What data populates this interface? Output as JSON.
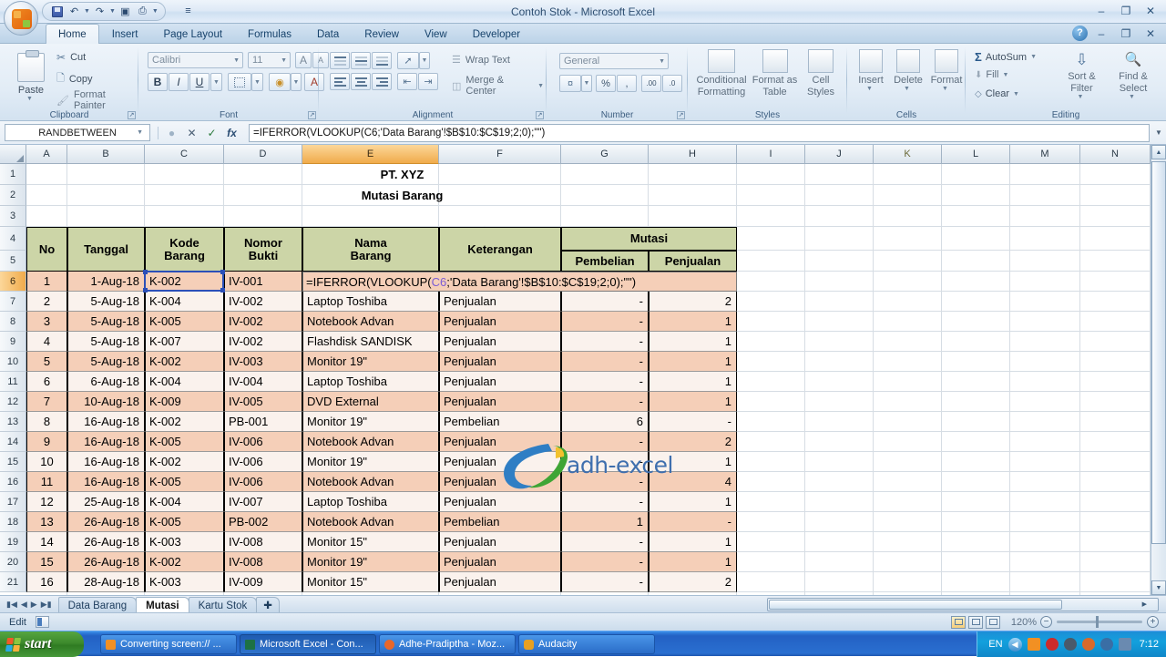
{
  "window": {
    "title": "Contoh Stok - Microsoft Excel",
    "minimize": "–",
    "restore": "❐",
    "close": "✕",
    "help": "?"
  },
  "quick_access": {
    "save": "save-icon",
    "undo": "undo-icon",
    "redo": "redo-icon",
    "camera": "camera-icon",
    "print_preview": "print-icon",
    "customize": "≡"
  },
  "ribbon": {
    "tabs": [
      {
        "label": "Home",
        "active": true
      },
      {
        "label": "Insert",
        "active": false
      },
      {
        "label": "Page Layout",
        "active": false
      },
      {
        "label": "Formulas",
        "active": false
      },
      {
        "label": "Data",
        "active": false
      },
      {
        "label": "Review",
        "active": false
      },
      {
        "label": "View",
        "active": false
      },
      {
        "label": "Developer",
        "active": false
      }
    ],
    "groups": {
      "clipboard": {
        "label": "Clipboard",
        "paste": "Paste",
        "cut": "Cut",
        "copy": "Copy",
        "format_painter": "Format Painter"
      },
      "font": {
        "label": "Font",
        "font_name": "Calibri",
        "font_size": "11",
        "grow": "A",
        "shrink": "A",
        "bold": "B",
        "italic": "I",
        "underline": "U",
        "borders": "borders-icon",
        "fill_color": "fill-color-icon",
        "font_color": "A"
      },
      "alignment": {
        "label": "Alignment",
        "wrap_text": "Wrap Text",
        "merge_center": "Merge & Center"
      },
      "number": {
        "label": "Number",
        "format": "General",
        "accounting": "accounting-icon",
        "percent": "%",
        "comma": ",",
        "increase_decimal": "increase-decimal-icon",
        "decrease_decimal": "decrease-decimal-icon"
      },
      "styles": {
        "label": "Styles",
        "conditional_formatting": "Conditional Formatting",
        "format_as_table": "Format as Table",
        "cell_styles": "Cell Styles"
      },
      "cells": {
        "label": "Cells",
        "insert": "Insert",
        "delete": "Delete",
        "format": "Format"
      },
      "editing": {
        "label": "Editing",
        "autosum": "AutoSum",
        "fill": "Fill",
        "clear": "Clear",
        "sort_filter": "Sort & Filter",
        "find_select": "Find & Select"
      }
    }
  },
  "formula_bar": {
    "name_box": "RANDBETWEEN",
    "cancel": "✕",
    "enter": "✓",
    "insert_function": "fx",
    "formula": "=IFERROR(VLOOKUP(C6;'Data Barang'!$B$10:$C$19;2;0);\"\")"
  },
  "grid": {
    "columns": [
      "A",
      "B",
      "C",
      "D",
      "E",
      "F",
      "G",
      "H",
      "I",
      "J",
      "K",
      "L",
      "M",
      "N"
    ],
    "selected_column": "E",
    "rows": [
      "1",
      "2",
      "3",
      "4",
      "5",
      "6",
      "7",
      "8",
      "9",
      "10",
      "11",
      "12",
      "13",
      "14",
      "15",
      "16",
      "17",
      "18",
      "19",
      "20",
      "21"
    ],
    "selected_row": "6",
    "title_line1": "PT. XYZ",
    "title_line2": "Mutasi Barang",
    "headers": {
      "no": "No",
      "tanggal": "Tanggal",
      "kode_barang_1": "Kode",
      "kode_barang_2": "Barang",
      "nomor_bukti_1": "Nomor",
      "nomor_bukti_2": "Bukti",
      "nama_barang_1": "Nama",
      "nama_barang_2": "Barang",
      "keterangan": "Keterangan",
      "mutasi": "Mutasi",
      "pembelian": "Pembelian",
      "penjualan": "Penjualan"
    },
    "active_cell_formula": "=IFERROR(VLOOKUP(C6;'Data Barang'!$B$10:$C$19;2;0);\"\")",
    "active_cell_formula_ref": "C6",
    "data": [
      {
        "no": "1",
        "tanggal": "1-Aug-18",
        "kode": "K-002",
        "bukti": "IV-001",
        "nama": "",
        "ket": "",
        "beli": "",
        "jual": ""
      },
      {
        "no": "2",
        "tanggal": "5-Aug-18",
        "kode": "K-004",
        "bukti": "IV-002",
        "nama": "Laptop Toshiba",
        "ket": "Penjualan",
        "beli": "-",
        "jual": "2"
      },
      {
        "no": "3",
        "tanggal": "5-Aug-18",
        "kode": "K-005",
        "bukti": "IV-002",
        "nama": "Notebook Advan",
        "ket": "Penjualan",
        "beli": "-",
        "jual": "1"
      },
      {
        "no": "4",
        "tanggal": "5-Aug-18",
        "kode": "K-007",
        "bukti": "IV-002",
        "nama": "Flashdisk SANDISK",
        "ket": "Penjualan",
        "beli": "-",
        "jual": "1"
      },
      {
        "no": "5",
        "tanggal": "5-Aug-18",
        "kode": "K-002",
        "bukti": "IV-003",
        "nama": "Monitor 19\"",
        "ket": "Penjualan",
        "beli": "-",
        "jual": "1"
      },
      {
        "no": "6",
        "tanggal": "6-Aug-18",
        "kode": "K-004",
        "bukti": "IV-004",
        "nama": "Laptop Toshiba",
        "ket": "Penjualan",
        "beli": "-",
        "jual": "1"
      },
      {
        "no": "7",
        "tanggal": "10-Aug-18",
        "kode": "K-009",
        "bukti": "IV-005",
        "nama": "DVD External",
        "ket": "Penjualan",
        "beli": "-",
        "jual": "1"
      },
      {
        "no": "8",
        "tanggal": "16-Aug-18",
        "kode": "K-002",
        "bukti": "PB-001",
        "nama": "Monitor 19\"",
        "ket": "Pembelian",
        "beli": "6",
        "jual": "-"
      },
      {
        "no": "9",
        "tanggal": "16-Aug-18",
        "kode": "K-005",
        "bukti": "IV-006",
        "nama": "Notebook Advan",
        "ket": "Penjualan",
        "beli": "-",
        "jual": "2"
      },
      {
        "no": "10",
        "tanggal": "16-Aug-18",
        "kode": "K-002",
        "bukti": "IV-006",
        "nama": "Monitor 19\"",
        "ket": "Penjualan",
        "beli": "-",
        "jual": "1"
      },
      {
        "no": "11",
        "tanggal": "16-Aug-18",
        "kode": "K-005",
        "bukti": "IV-006",
        "nama": "Notebook Advan",
        "ket": "Penjualan",
        "beli": "-",
        "jual": "4"
      },
      {
        "no": "12",
        "tanggal": "25-Aug-18",
        "kode": "K-004",
        "bukti": "IV-007",
        "nama": "Laptop Toshiba",
        "ket": "Penjualan",
        "beli": "-",
        "jual": "1"
      },
      {
        "no": "13",
        "tanggal": "26-Aug-18",
        "kode": "K-005",
        "bukti": "PB-002",
        "nama": "Notebook Advan",
        "ket": "Pembelian",
        "beli": "1",
        "jual": "-"
      },
      {
        "no": "14",
        "tanggal": "26-Aug-18",
        "kode": "K-003",
        "bukti": "IV-008",
        "nama": "Monitor 15\"",
        "ket": "Penjualan",
        "beli": "-",
        "jual": "1"
      },
      {
        "no": "15",
        "tanggal": "26-Aug-18",
        "kode": "K-002",
        "bukti": "IV-008",
        "nama": "Monitor 19\"",
        "ket": "Penjualan",
        "beli": "-",
        "jual": "1"
      },
      {
        "no": "16",
        "tanggal": "28-Aug-18",
        "kode": "K-003",
        "bukti": "IV-009",
        "nama": "Monitor 15\"",
        "ket": "Penjualan",
        "beli": "-",
        "jual": "2"
      }
    ],
    "watermark": "adh-excel"
  },
  "sheet_tabs": {
    "first": "⏮",
    "prev": "◀",
    "next": "▶",
    "last": "⏭",
    "items": [
      {
        "label": "Data Barang",
        "active": false
      },
      {
        "label": "Mutasi",
        "active": true
      },
      {
        "label": "Kartu Stok",
        "active": false
      }
    ],
    "new_sheet": "new-sheet-icon"
  },
  "status_bar": {
    "mode": "Edit",
    "macro_icon": "record-macro-icon",
    "view_normal": "normal-view-icon",
    "view_layout": "page-layout-view-icon",
    "view_break": "page-break-view-icon",
    "zoom_level": "120%",
    "zoom_out": "−",
    "zoom_in": "+"
  },
  "taskbar": {
    "start": "start",
    "items": [
      {
        "label": "Converting screen:// ...",
        "active": false,
        "icon_color": "#f29023"
      },
      {
        "label": "Microsoft Excel - Con...",
        "active": true,
        "icon_color": "#1d7145"
      },
      {
        "label": "Adhe-Pradiptha - Moz...",
        "active": false,
        "icon_color": "#e8672a"
      },
      {
        "label": "Audacity",
        "active": false,
        "icon_color": "#e8a020"
      }
    ],
    "tray": {
      "language": "EN",
      "clock": "7:12"
    }
  },
  "colors": {
    "header_green": "#ccd5a7",
    "band_peach": "#f5cfb8",
    "selection_blue": "#2b4fb8",
    "column_header_selected": "#f0ab4b"
  }
}
